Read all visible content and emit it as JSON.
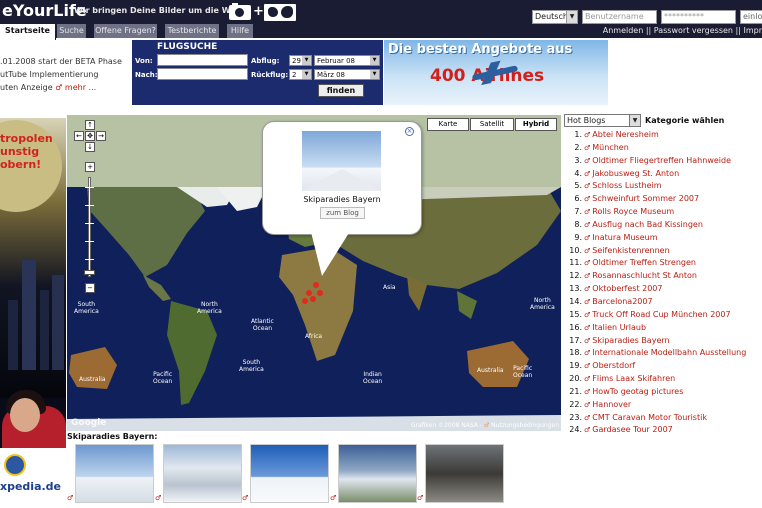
{
  "header": {
    "logo": "eYourLife",
    "tagline": "Wir bringen Deine Bilder um die Welt",
    "language": "Deutsch",
    "username_placeholder": "Benutzername",
    "password_value": "**********",
    "login_cut": "einlo",
    "links": "Anmelden || Passwort vergessen || Impr"
  },
  "tabs": [
    {
      "label": "Startseite",
      "active": true
    },
    {
      "label": "Suche"
    },
    {
      "label": "Offene Fragen?"
    },
    {
      "label": "Testberichte"
    },
    {
      "label": "Hilfe"
    }
  ],
  "news": {
    "line1": ".01.2008 start der BETA Phase",
    "line2": "utTube Implementierung",
    "line3": "uten Anzeige",
    "more": "mehr ..."
  },
  "flight_search": {
    "title": "FLUGSUCHE",
    "von": "Von:",
    "nach": "Nach:",
    "abflug": "Abflug:",
    "rueckflug": "Rückflug:",
    "abflug_day": "29",
    "abflug_month": "Februar 08",
    "rueck_day": "2",
    "rueck_month": "März 08",
    "button": "finden"
  },
  "banner": {
    "line1": "Die besten Angebote aus",
    "line2": "400      Airlines"
  },
  "left_ad": {
    "slogan1": "tropolen",
    "slogan2": "unstig",
    "slogan3": "obern!",
    "domain": "xpedia.de"
  },
  "map": {
    "types": [
      "Karte",
      "Satellit",
      "Hybrid"
    ],
    "active_type": "Hybrid",
    "pan": {
      "up": "↑",
      "left": "←",
      "center": "✥",
      "right": "→",
      "down": "↓"
    },
    "zoom_in": "+",
    "zoom_out": "−",
    "labels": {
      "na": "North\nAmerica",
      "atl": "Atlantic\nOcean",
      "sa": "South\nAmerica",
      "africa": "Africa",
      "asia": "Asia",
      "io": "Indian\nOcean",
      "pac": "Pacific\nOcean",
      "pac2": "Pacific\nOcean",
      "australia": "Australia",
      "australia2": "Australia",
      "na2": "North\nAmerica",
      "sa2": "South\nAmerica"
    },
    "credit": "Grafiken ©2008 NASA -",
    "credit_link": "Nutzungsbedingungen",
    "powered": "Google"
  },
  "popup": {
    "title": "Skiparadies Bayern",
    "button": "zum Blog",
    "close": "×"
  },
  "category": {
    "selected": "Hot Blogs",
    "label": "Kategorie wählen"
  },
  "blogs": [
    {
      "num": "1.",
      "title": "Abtei Neresheim"
    },
    {
      "num": "2.",
      "title": "München"
    },
    {
      "num": "3.",
      "title": "Oldtimer Fliegertreffen Hahnweide"
    },
    {
      "num": "4.",
      "title": "Jakobusweg St. Anton"
    },
    {
      "num": "5.",
      "title": "Schloss Lustheim"
    },
    {
      "num": "6.",
      "title": "Schweinfurt Sommer 2007"
    },
    {
      "num": "7.",
      "title": "Rolls Royce Museum"
    },
    {
      "num": "8.",
      "title": "Ausflug nach Bad Kissingen"
    },
    {
      "num": "9.",
      "title": "Inatura Museum"
    },
    {
      "num": "10.",
      "title": "Seifenkistenrennen"
    },
    {
      "num": "11.",
      "title": "Oldtimer Treffen Strengen"
    },
    {
      "num": "12.",
      "title": "Rosannaschlucht St Anton"
    },
    {
      "num": "13.",
      "title": "Oktoberfest 2007"
    },
    {
      "num": "14.",
      "title": "Barcelona2007"
    },
    {
      "num": "15.",
      "title": "Truck Off Road Cup München 2007"
    },
    {
      "num": "16.",
      "title": "Italien Urlaub"
    },
    {
      "num": "17.",
      "title": "Skiparadies Bayern"
    },
    {
      "num": "18.",
      "title": "Internationale Modellbahn Ausstellung"
    },
    {
      "num": "19.",
      "title": "Oberstdorf"
    },
    {
      "num": "20.",
      "title": "Flims Laax Skifahren"
    },
    {
      "num": "21.",
      "title": "HowTo geotag pictures"
    },
    {
      "num": "22.",
      "title": "Hannover"
    },
    {
      "num": "23.",
      "title": "CMT Caravan Motor Touristik"
    },
    {
      "num": "24.",
      "title": "Gardasee Tour 2007"
    }
  ],
  "thumbnails": {
    "title": "Skiparadies Bayern:",
    "count": 5
  }
}
